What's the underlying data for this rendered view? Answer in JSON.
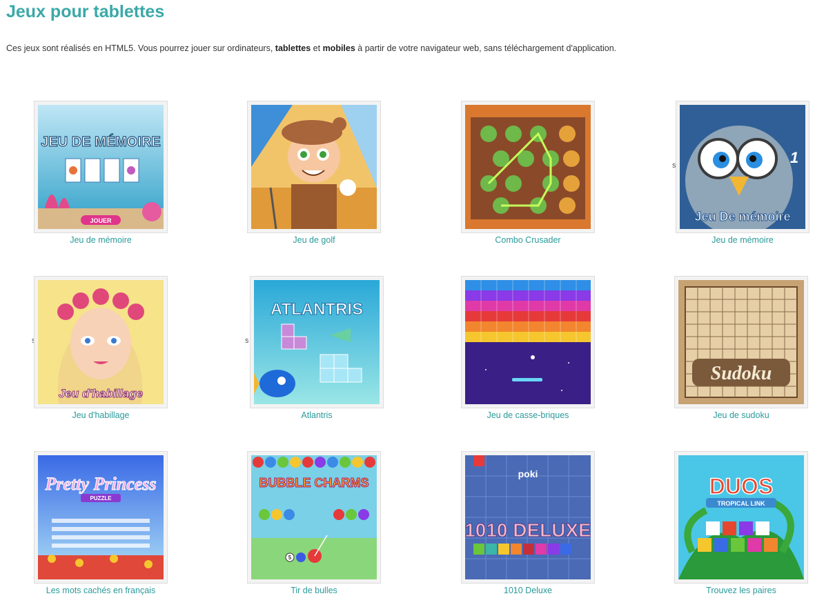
{
  "page": {
    "title": "Jeux pour tablettes",
    "intro": {
      "part1": "Ces jeux sont réalisés en HTML5. Vous pourrez jouer sur ordinateurs, ",
      "bold1": "tablettes",
      "part2": " et ",
      "bold2": "mobiles",
      "part3": " à partir de votre navigateur web, sans téléchargement d'application."
    },
    "stray_mark": "s"
  },
  "colors": {
    "title": "#3ba8a8",
    "link": "#2a9a9a",
    "text": "#333333"
  },
  "games": [
    {
      "label": "Jeu de mémoire",
      "art_text": "JEU DE MÉMOIRE",
      "button": "JOUER"
    },
    {
      "label": "Jeu de golf"
    },
    {
      "label": "Combo Crusader"
    },
    {
      "label": "Jeu de mémoire",
      "art_text": "Jeu De mémoire",
      "badge": "1"
    },
    {
      "label": "Jeu d'habillage",
      "art_text": "Jeu d'habillage"
    },
    {
      "label": "Atlantris",
      "art_text": "ATLANTRIS"
    },
    {
      "label": "Jeu de casse-briques"
    },
    {
      "label": "Jeu de sudoku",
      "art_text": "Sudoku"
    },
    {
      "label": "Les mots cachés en français",
      "art_text": "Pretty Princess",
      "art_sub": "PUZZLE"
    },
    {
      "label": "Tir de bulles",
      "art_text": "BUBBLE CHARMS",
      "counter": "5"
    },
    {
      "label": "1010 Deluxe",
      "art_text": "1010 DELUXE",
      "brand": "poki"
    },
    {
      "label": "Trouvez les paires",
      "art_text": "DUOS",
      "art_sub": "TROPICAL LINK"
    }
  ]
}
